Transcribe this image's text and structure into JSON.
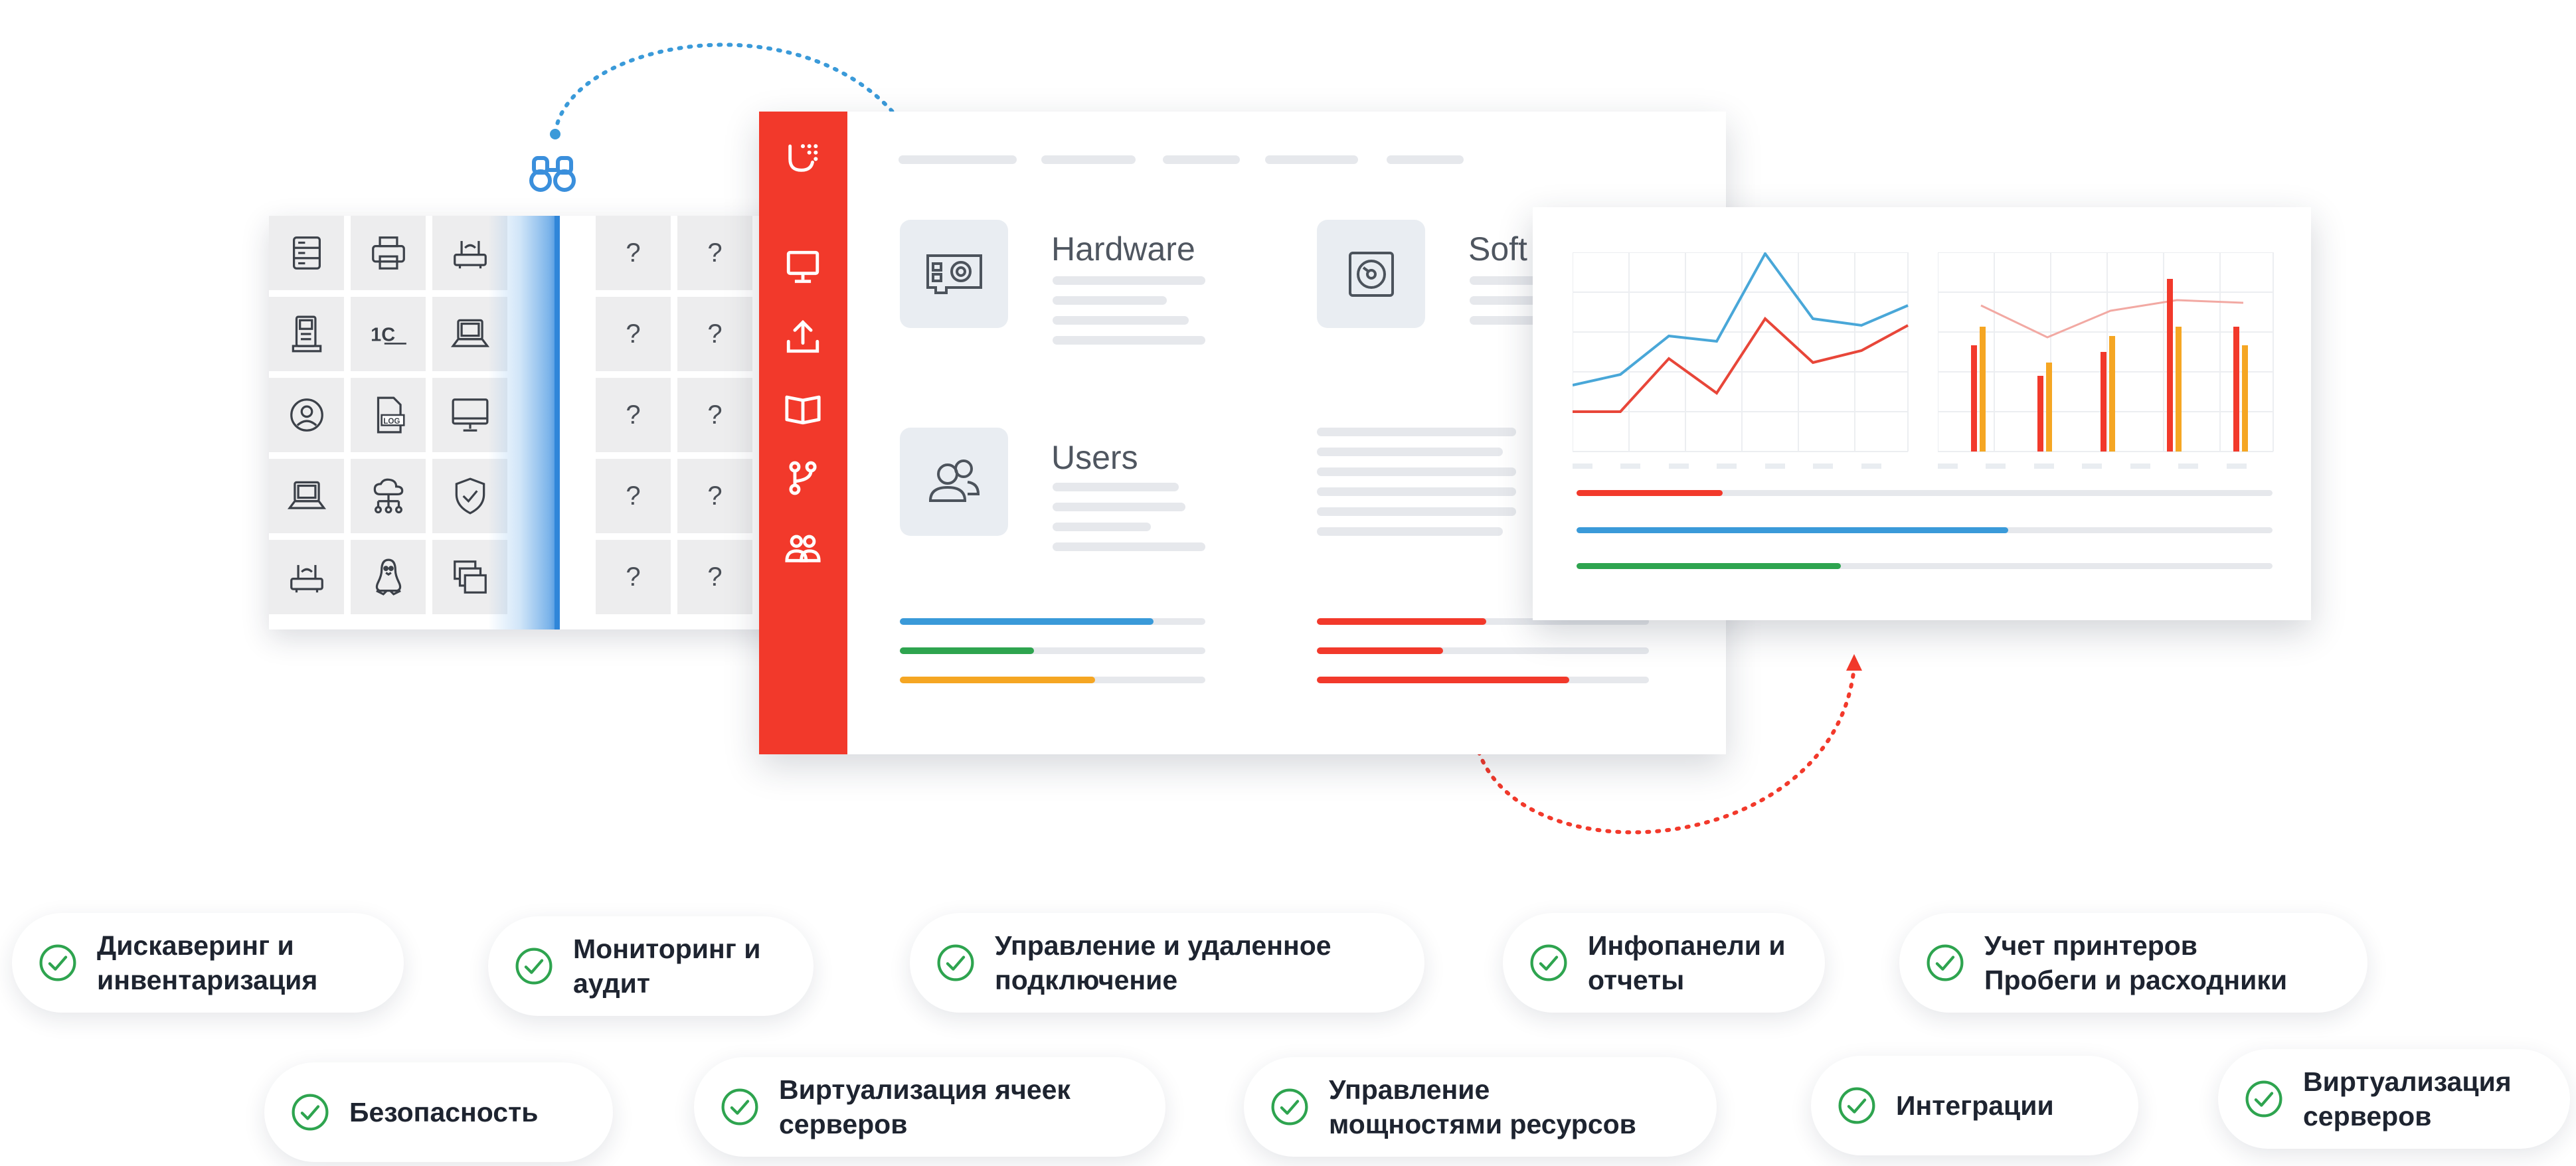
{
  "hardware_section": {
    "title": "Hardware"
  },
  "software_section": {
    "title": "Soft"
  },
  "users_section": {
    "title": "Users"
  },
  "device_grid": {
    "unknown_marker": "?",
    "icons": [
      [
        "server-icon",
        "printer-icon",
        "router-icon"
      ],
      [
        "phone-icon",
        "1c-logo-icon",
        "laptop-icon"
      ],
      [
        "user-circle-icon",
        "log-file-icon",
        "monitor-icon"
      ],
      [
        "laptop-icon",
        "cloud-network-icon",
        "shield-check-icon"
      ],
      [
        "router-icon",
        "linux-icon",
        "virtual-machines-icon"
      ]
    ],
    "icon_1c_text": "1С",
    "icon_log_text": "LOG"
  },
  "sidebar_icons": [
    "logo-icon",
    "monitor-icon",
    "upload-icon",
    "book-icon",
    "git-branch-icon",
    "users-icon"
  ],
  "colors": {
    "accent_red": "#f2392b",
    "blue": "#3a9ad9",
    "green": "#2ea44f",
    "orange": "#f5a623",
    "check_green": "#2ea44f"
  },
  "progress": {
    "hardware": [
      {
        "color": "blue",
        "value": 0.83
      },
      {
        "color": "green",
        "value": 0.44
      },
      {
        "color": "orange",
        "value": 0.64
      }
    ],
    "software": [
      {
        "color": "red",
        "value": 0.51
      },
      {
        "color": "red",
        "value": 0.38
      },
      {
        "color": "red",
        "value": 0.76
      }
    ],
    "report": [
      {
        "color": "red",
        "value": 0.21
      },
      {
        "color": "blue",
        "value": 0.62
      },
      {
        "color": "green",
        "value": 0.38
      }
    ]
  },
  "features": {
    "row1": [
      {
        "id": "discovery",
        "label": "Дискаверинг и\nинвентаризация"
      },
      {
        "id": "monitoring",
        "label": "Мониторинг и\nаудит"
      },
      {
        "id": "remote",
        "label": "Управление и удаленное\nподключение"
      },
      {
        "id": "dashboards",
        "label": "Инфопанели и\nотчеты"
      },
      {
        "id": "printers",
        "label": "Учет принтеров\nПробеги и расходники"
      }
    ],
    "row2": [
      {
        "id": "security",
        "label": "Безопасность"
      },
      {
        "id": "virtualization-cells",
        "label": "Виртуализация ячеек\nсерверов"
      },
      {
        "id": "capacity",
        "label": "Управление\nмощностями ресурсов"
      },
      {
        "id": "integrations",
        "label": "Интеграции"
      },
      {
        "id": "server-virtualization",
        "label": "Виртуализация\nсерверов"
      }
    ]
  }
}
